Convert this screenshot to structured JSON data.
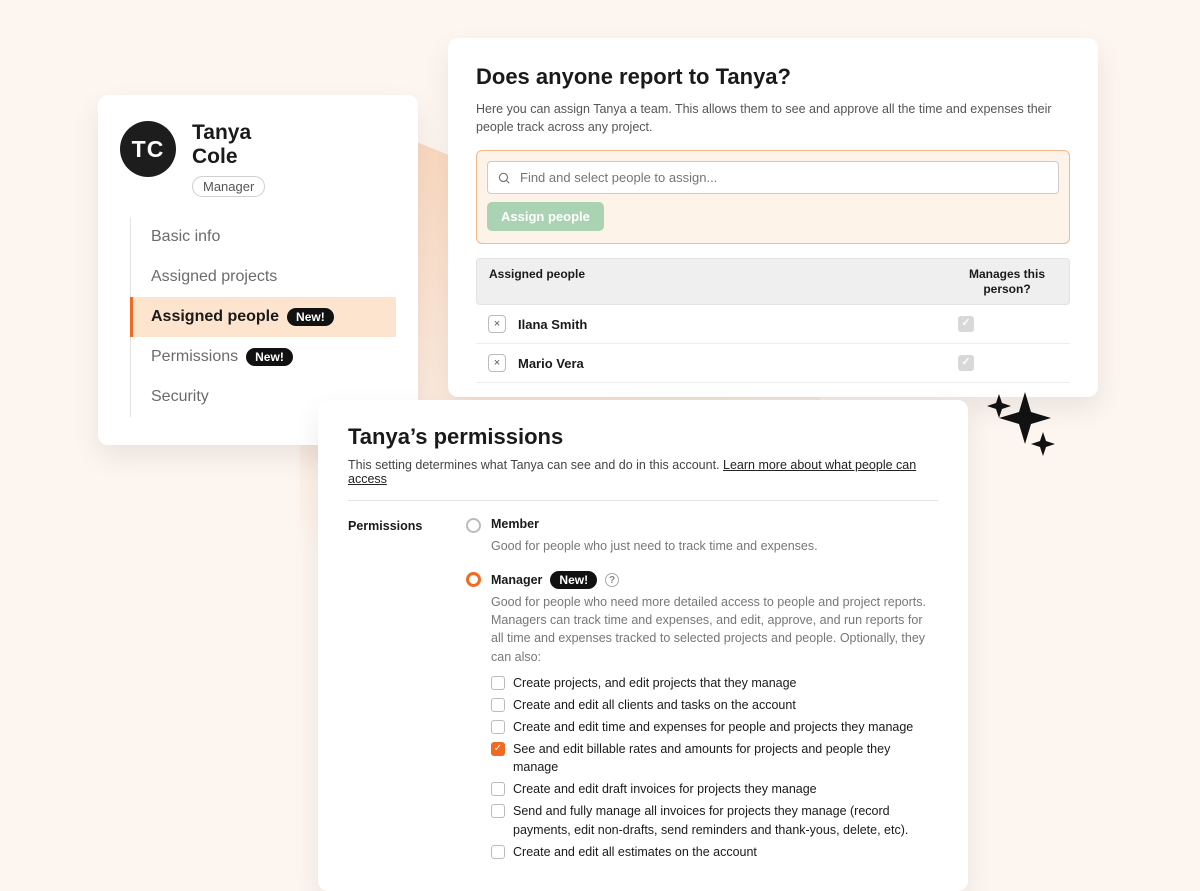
{
  "profile": {
    "initials": "TC",
    "name_first": "Tanya",
    "name_last": "Cole",
    "role_label": "Manager"
  },
  "nav": {
    "items": [
      {
        "label": "Basic info"
      },
      {
        "label": "Assigned projects"
      },
      {
        "label": "Assigned people",
        "badge": "New!",
        "active": true
      },
      {
        "label": "Permissions",
        "badge": "New!"
      },
      {
        "label": "Security"
      }
    ]
  },
  "assign": {
    "title": "Does anyone report to Tanya?",
    "description": "Here you can assign Tanya a team. This allows them to see and approve all the time and expenses their people track across any project.",
    "search_placeholder": "Find and select people to assign...",
    "assign_button": "Assign people",
    "header_col1": "Assigned people",
    "header_col2": "Manages this person?",
    "rows": [
      {
        "name": "Ilana Smith",
        "manages": true
      },
      {
        "name": "Mario Vera",
        "manages": true
      }
    ]
  },
  "permissions": {
    "title": "Tanya’s permissions",
    "description_prefix": "This setting determines what Tanya can see and do in this account. ",
    "learn_more": "Learn more about what people can access",
    "section_label": "Permissions",
    "member": {
      "label": "Member",
      "sub": "Good for people who just need to track time and expenses."
    },
    "manager": {
      "label": "Manager",
      "badge": "New!",
      "sub": "Good for people who need more detailed access to people and project reports. Managers can track time and expenses, and edit, approve, and run reports for all time and expenses tracked to selected projects and people. Optionally, they can also:",
      "options": [
        {
          "label": "Create projects, and edit projects that they manage",
          "checked": false
        },
        {
          "label": "Create and edit all clients and tasks on the account",
          "checked": false
        },
        {
          "label": "Create and edit time and expenses for people and projects they manage",
          "checked": false
        },
        {
          "label": "See and edit billable rates and amounts for projects and people they manage",
          "checked": true
        },
        {
          "label": "Create and edit draft invoices for projects they manage",
          "checked": false
        },
        {
          "label": "Send and fully manage all invoices for projects they manage (record payments, edit non-drafts, send reminders and thank-yous, delete, etc).",
          "checked": false
        },
        {
          "label": "Create and edit all estimates on the account",
          "checked": false
        }
      ]
    }
  }
}
